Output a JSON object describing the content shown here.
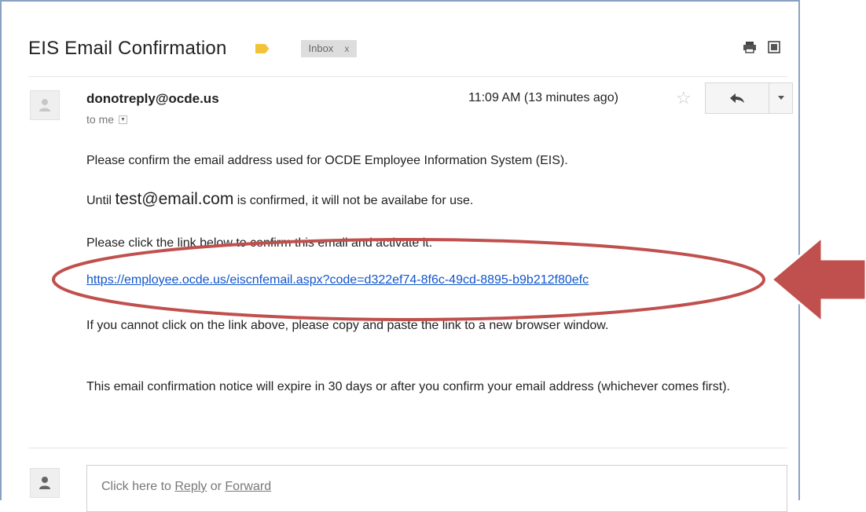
{
  "email": {
    "subject": "EIS Email Confirmation",
    "label_chip": "Inbox",
    "label_chip_close": "x",
    "sender": "donotreply@ocde.us",
    "recipient_line": "to me",
    "time": "11:09 AM (13 minutes ago)",
    "body": {
      "p1": "Please confirm the email address used for OCDE Employee Information System (EIS).",
      "p2_prefix": "Until ",
      "p2_email": "test@email.com",
      "p2_suffix": " is confirmed, it will not be availabe for use.",
      "p3": "Please click the link below to confirm this email and activate it.",
      "link": "https://employee.ocde.us/eiscnfemail.aspx?code=d322ef74-8f6c-49cd-8895-b9b212f80efc",
      "p4": "If you cannot click on the link above, please copy and paste the link to a new browser window.",
      "p5": "This email confirmation notice will expire in 30 days or after you confirm your email address (whichever comes first)."
    },
    "reply_box": {
      "prefix": "Click here to ",
      "reply": "Reply",
      "middle": " or ",
      "forward": "Forward"
    }
  },
  "icons": {
    "print": "print-icon",
    "new_window": "new-window-icon",
    "star": "star-icon",
    "reply": "reply-icon",
    "more": "chevron-down-icon",
    "avatar": "avatar-icon"
  },
  "colors": {
    "link": "#1155cc",
    "annotation": "#c0504d",
    "importance": "#f3c337",
    "frame": "#8aa2c2"
  }
}
